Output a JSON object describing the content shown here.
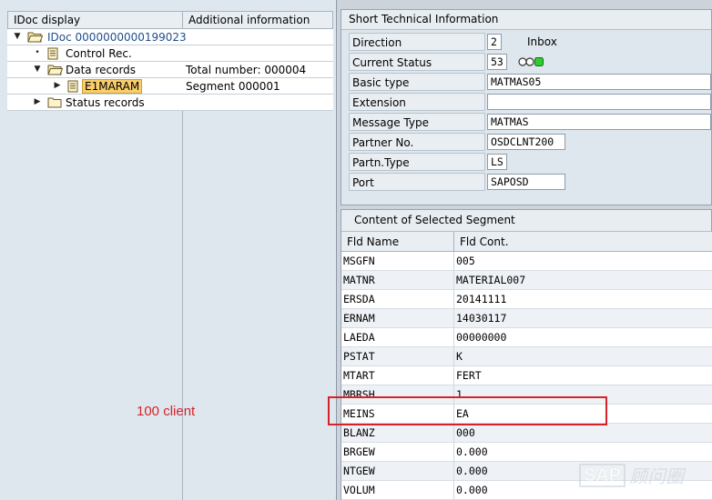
{
  "tree": {
    "header": {
      "col1": "IDoc display",
      "col2": "Additional information"
    },
    "rows": [
      {
        "label": "IDoc 0000000000199023",
        "info": ""
      },
      {
        "label": "Control Rec.",
        "info": ""
      },
      {
        "label": "Data records",
        "info": "Total number: 000004"
      },
      {
        "label": "E1MARAM",
        "info": "Segment 000001"
      },
      {
        "label": "Status records",
        "info": ""
      }
    ]
  },
  "annotation": "100 client",
  "technical_info": {
    "title": "Short Technical Information",
    "fields": [
      {
        "label": "Direction",
        "value": "2",
        "extra": "Inbox"
      },
      {
        "label": "Current Status",
        "value": "53",
        "extra": ""
      },
      {
        "label": "Basic type",
        "value": "MATMAS05",
        "extra": ""
      },
      {
        "label": "Extension",
        "value": "",
        "extra": ""
      },
      {
        "label": "Message Type",
        "value": "MATMAS",
        "extra": ""
      },
      {
        "label": "Partner No.",
        "value": "OSDCLNT200",
        "extra": ""
      },
      {
        "label": "Partn.Type",
        "value": "LS",
        "extra": ""
      },
      {
        "label": "Port",
        "value": "SAPOSD",
        "extra": ""
      }
    ],
    "status_colors": {
      "lamp_off": "#ffffff",
      "lamp_green": "#2ecc2e"
    }
  },
  "segment": {
    "title": "Content of Selected Segment",
    "header": {
      "name": "Fld Name",
      "value": "Fld Cont."
    },
    "rows": [
      {
        "name": "MSGFN",
        "value": "005"
      },
      {
        "name": "MATNR",
        "value": "MATERIAL007"
      },
      {
        "name": "ERSDA",
        "value": "20141111"
      },
      {
        "name": "ERNAM",
        "value": "14030117"
      },
      {
        "name": "LAEDA",
        "value": "00000000"
      },
      {
        "name": "PSTAT",
        "value": "K"
      },
      {
        "name": "MTART",
        "value": "FERT"
      },
      {
        "name": "MBRSH",
        "value": "1"
      },
      {
        "name": "MEINS",
        "value": "EA"
      },
      {
        "name": "BLANZ",
        "value": "000"
      },
      {
        "name": "BRGEW",
        "value": "0.000"
      },
      {
        "name": "NTGEW",
        "value": "0.000"
      },
      {
        "name": "VOLUM",
        "value": "0.000"
      }
    ]
  },
  "watermark": {
    "brand": "SAP",
    "text": "顾问圈"
  },
  "colors": {
    "highlight": "#f8cd6a",
    "annotation": "#d5232a",
    "link": "#1f4e8c"
  }
}
